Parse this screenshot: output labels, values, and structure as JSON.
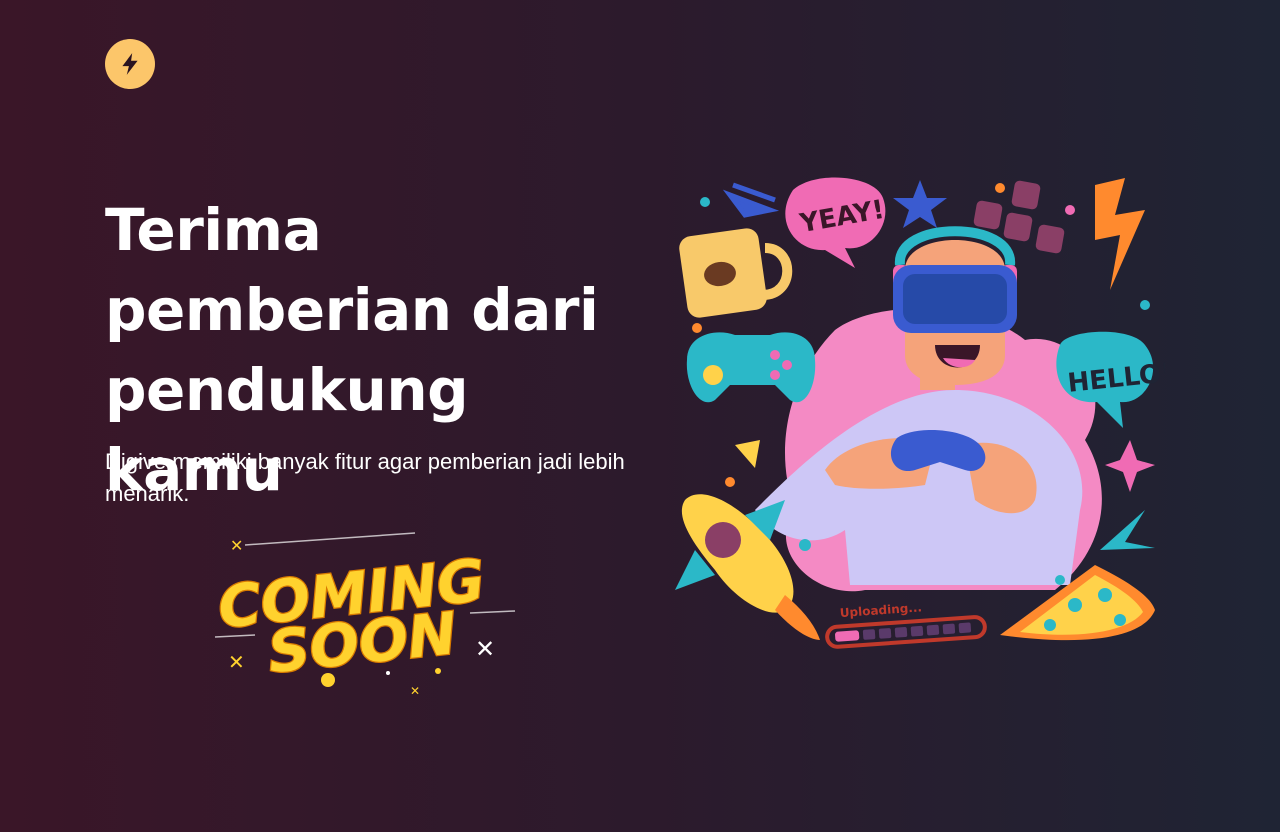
{
  "brand": {
    "logo_icon": "lightning-bolt-icon",
    "accent": "#fcc66a"
  },
  "hero": {
    "title": "Terima pemberian dari pendukung kamu",
    "subtitle": "Digive memiliki banyak fitur agar pemberian jadi lebih menarik."
  },
  "badge": {
    "line1": "COMING",
    "line2": "SOON"
  },
  "illustration": {
    "speech1": "YEAY!",
    "speech2": "HELLO!",
    "progress_label": "Uploading..."
  },
  "colors": {
    "background_start": "#3a1628",
    "background_end": "#1f2434",
    "badge_yellow": "#ffd22e"
  }
}
